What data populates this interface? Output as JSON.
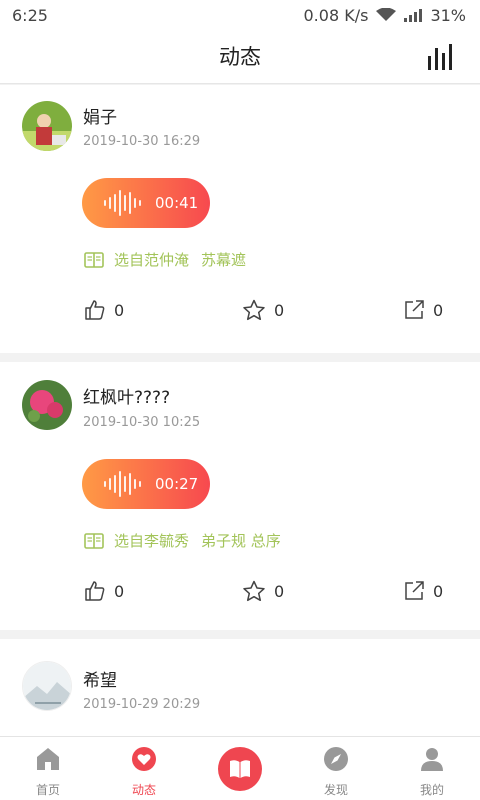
{
  "status_bar": {
    "time": "6:25",
    "network_speed": "0.08 K/s",
    "battery": "31%",
    "icons": [
      "wifi-icon",
      "signal-icon",
      "battery-icon"
    ]
  },
  "header": {
    "title": "动态",
    "right_icon": "bar-chart-icon"
  },
  "posts": [
    {
      "username": "娟子",
      "timestamp": "2019-10-30 16:29",
      "voice_duration": "00:41",
      "source_prefix": "选自范仲淹",
      "source_title": "苏幕遮",
      "likes": "0",
      "favorites": "0",
      "shares": "0"
    },
    {
      "username": "红枫叶????",
      "timestamp": "2019-10-30 10:25",
      "voice_duration": "00:27",
      "source_prefix": "选自李毓秀",
      "source_title": "弟子规 总序",
      "likes": "0",
      "favorites": "0",
      "shares": "0"
    },
    {
      "username": "希望",
      "timestamp": "2019-10-29 20:29"
    }
  ],
  "bottom_nav": {
    "items": [
      {
        "label": "首页",
        "icon": "home-icon"
      },
      {
        "label": "动态",
        "icon": "heart-icon",
        "active": true
      },
      {
        "label": "",
        "icon": "book-icon"
      },
      {
        "label": "发现",
        "icon": "compass-icon"
      },
      {
        "label": "我的",
        "icon": "person-icon"
      }
    ]
  },
  "colors": {
    "accent": "#ef4650",
    "gradient_start": "#ff9a45",
    "gradient_end": "#f7494f",
    "source_green": "#a3c45a"
  }
}
